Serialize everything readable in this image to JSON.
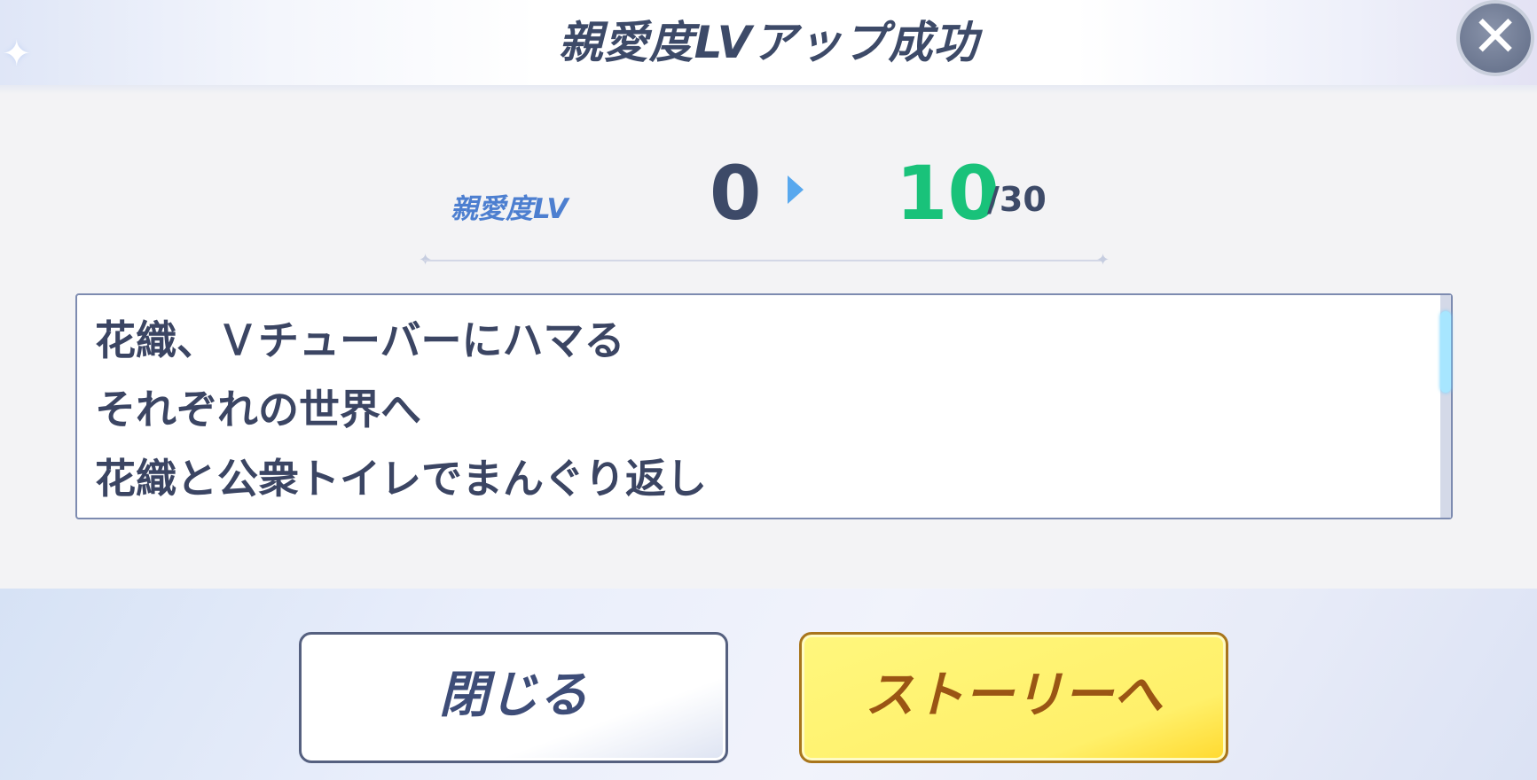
{
  "header": {
    "title": "親愛度LVアップ成功",
    "close_icon": "✕"
  },
  "level": {
    "label": "親愛度LV",
    "from": "0",
    "to": "10",
    "max": "/30",
    "arrow_icon": "play-arrow"
  },
  "stories": [
    "花織、Ｖチューバーにハマる",
    "それぞれの世界へ",
    "花織と公衆トイレでまんぐり返し"
  ],
  "buttons": {
    "close_label": "閉じる",
    "story_label": "ストーリーへ"
  },
  "colors": {
    "accent_green": "#19c27a",
    "label_blue": "#4d7fd0",
    "story_button": "#fff06a",
    "text_dark": "#3d4a68"
  }
}
